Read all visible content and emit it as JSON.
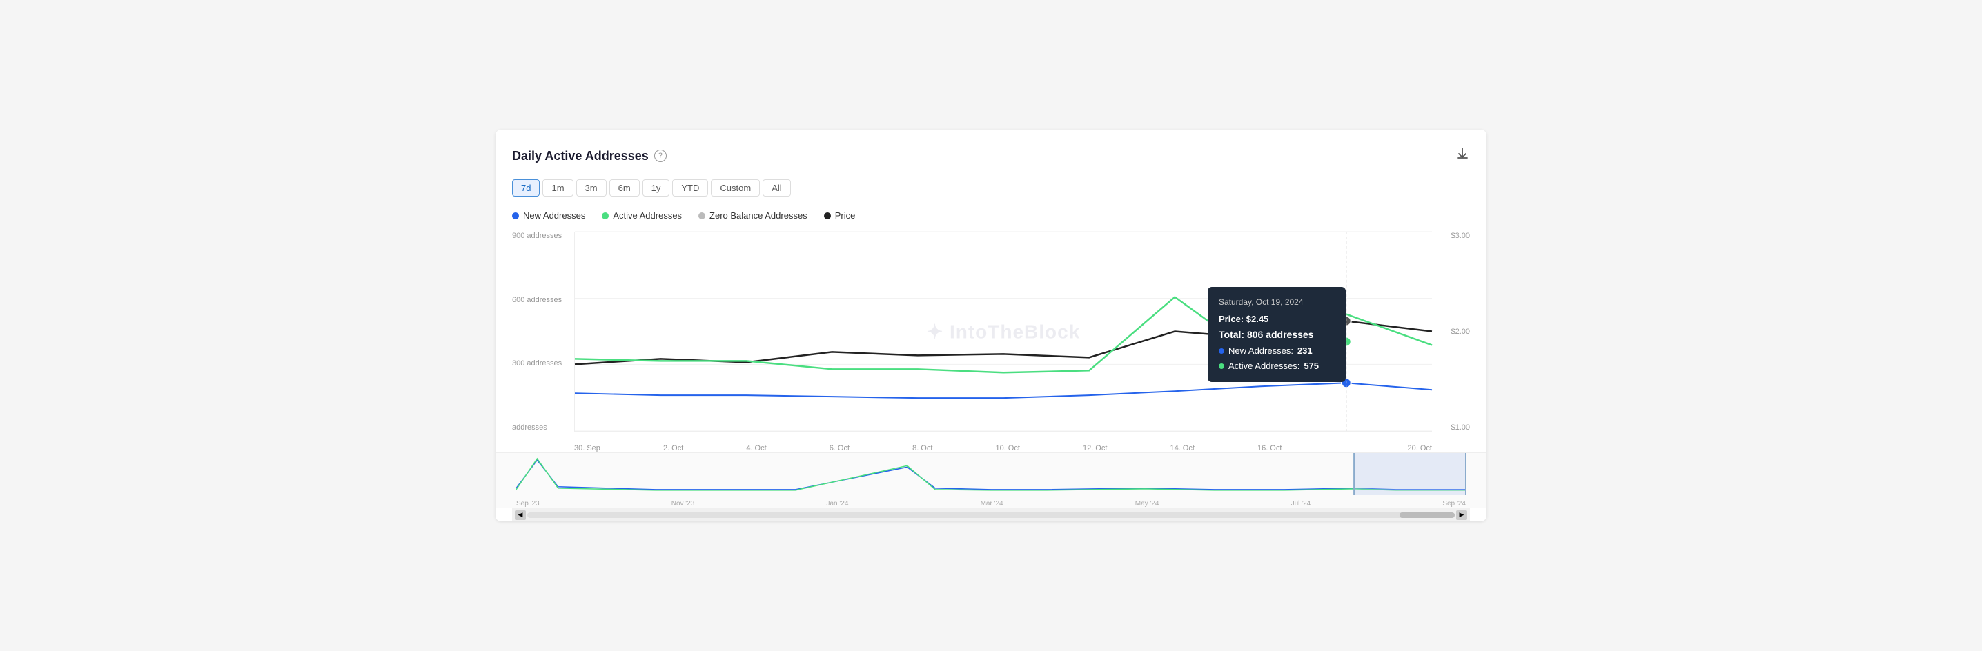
{
  "header": {
    "title": "Daily Active Addresses",
    "help_label": "?",
    "download_label": "⬇"
  },
  "filters": {
    "options": [
      "7d",
      "1m",
      "3m",
      "6m",
      "1y",
      "YTD",
      "Custom",
      "All"
    ],
    "active": "7d"
  },
  "legend": {
    "items": [
      {
        "label": "New Addresses",
        "color": "#2563eb"
      },
      {
        "label": "Active Addresses",
        "color": "#4ade80"
      },
      {
        "label": "Zero Balance Addresses",
        "color": "#bbb"
      },
      {
        "label": "Price",
        "color": "#222"
      }
    ]
  },
  "yaxis_left": {
    "labels": [
      "900 addresses",
      "600 addresses",
      "300 addresses",
      "addresses"
    ]
  },
  "yaxis_right": {
    "labels": [
      "$3.00",
      "$2.00",
      "$1.00"
    ]
  },
  "xaxis": {
    "labels": [
      "30. Sep",
      "2. Oct",
      "4. Oct",
      "6. Oct",
      "8. Oct",
      "10. Oct",
      "12. Oct",
      "14. Oct",
      "16. Oct",
      "",
      "20. Oct"
    ]
  },
  "tooltip": {
    "title": "Saturday, Oct 19, 2024",
    "price": "Price: $2.45",
    "total": "Total: 806 addresses",
    "new_addresses_label": "New Addresses:",
    "new_addresses_value": "231",
    "active_addresses_label": "Active Addresses:",
    "active_addresses_value": "575"
  },
  "mini_xaxis": {
    "labels": [
      "Sep '23",
      "Nov '23",
      "Jan '24",
      "Mar '24",
      "May '24",
      "Jul '24",
      "Sep '24"
    ]
  },
  "watermark": "✦ IntoTheBlock"
}
